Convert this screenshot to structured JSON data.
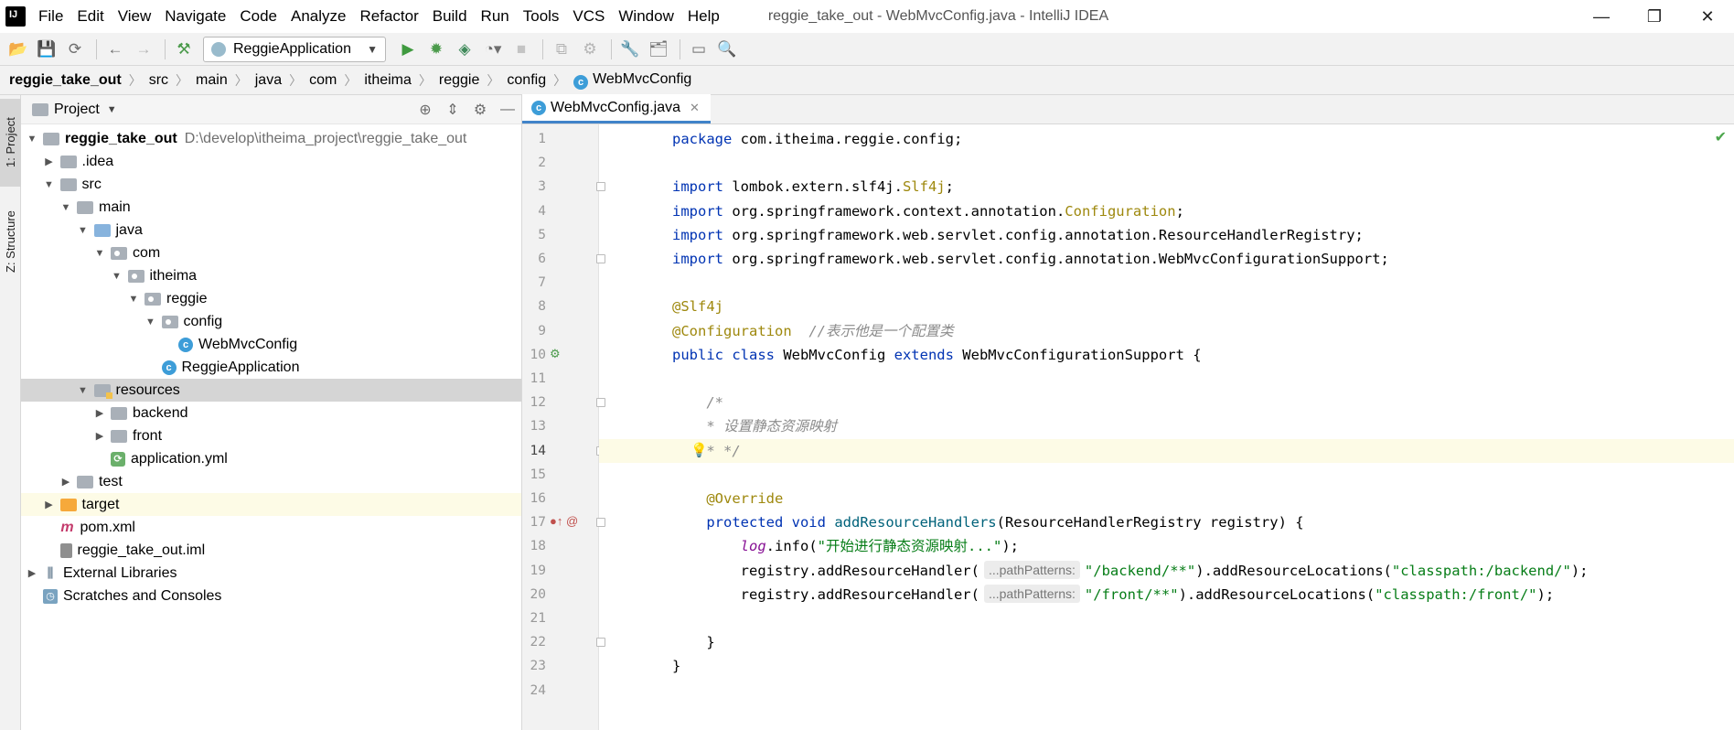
{
  "app": {
    "logo_text": "IJ",
    "window_title": "reggie_take_out - WebMvcConfig.java - IntelliJ IDEA",
    "menu": [
      "File",
      "Edit",
      "View",
      "Navigate",
      "Code",
      "Analyze",
      "Refactor",
      "Build",
      "Run",
      "Tools",
      "VCS",
      "Window",
      "Help"
    ],
    "window_controls": {
      "minimize": "—",
      "restore": "❐",
      "close": "✕"
    }
  },
  "toolbar": {
    "run_config": "ReggieApplication",
    "icons": [
      "open-icon",
      "save-icon",
      "sync-icon",
      "back-icon",
      "forward-icon",
      "build-hammer-icon",
      "run-icon",
      "debug-icon",
      "coverage-icon",
      "profile-icon",
      "stop-icon",
      "attach-icon",
      "deploy-icon",
      "settings-wrench-icon",
      "project-structure-icon",
      "terminal-icon",
      "search-icon"
    ]
  },
  "breadcrumb": [
    "reggie_take_out",
    "src",
    "main",
    "java",
    "com",
    "itheima",
    "reggie",
    "config",
    "WebMvcConfig"
  ],
  "side_strip": {
    "project_tab": "1: Project",
    "structure_tab": "Z: Structure"
  },
  "project_panel": {
    "title": "Project",
    "tree": [
      {
        "depth": 0,
        "arrow": "▼",
        "icon": "module",
        "label": "reggie_take_out",
        "extra": "D:\\develop\\itheima_project\\reggie_take_out",
        "bold": true
      },
      {
        "depth": 1,
        "arrow": "▶",
        "icon": "folder",
        "label": ".idea"
      },
      {
        "depth": 1,
        "arrow": "▼",
        "icon": "folder",
        "label": "src"
      },
      {
        "depth": 2,
        "arrow": "▼",
        "icon": "folder",
        "label": "main"
      },
      {
        "depth": 3,
        "arrow": "▼",
        "icon": "folder-blue",
        "label": "java"
      },
      {
        "depth": 4,
        "arrow": "▼",
        "icon": "package",
        "label": "com"
      },
      {
        "depth": 5,
        "arrow": "▼",
        "icon": "package",
        "label": "itheima"
      },
      {
        "depth": 6,
        "arrow": "▼",
        "icon": "package",
        "label": "reggie"
      },
      {
        "depth": 7,
        "arrow": "▼",
        "icon": "package",
        "label": "config"
      },
      {
        "depth": 8,
        "arrow": "",
        "icon": "class",
        "label": "WebMvcConfig"
      },
      {
        "depth": 7,
        "arrow": "",
        "icon": "class",
        "label": "ReggieApplication"
      },
      {
        "depth": 3,
        "arrow": "▼",
        "icon": "resources",
        "label": "resources",
        "selected": true
      },
      {
        "depth": 4,
        "arrow": "▶",
        "icon": "folder",
        "label": "backend"
      },
      {
        "depth": 4,
        "arrow": "▶",
        "icon": "folder",
        "label": "front"
      },
      {
        "depth": 4,
        "arrow": "",
        "icon": "yml",
        "label": "application.yml"
      },
      {
        "depth": 2,
        "arrow": "▶",
        "icon": "folder",
        "label": "test"
      },
      {
        "depth": 1,
        "arrow": "▶",
        "icon": "folder-orange",
        "label": "target",
        "highlight": true
      },
      {
        "depth": 1,
        "arrow": "",
        "icon": "maven",
        "label": "pom.xml"
      },
      {
        "depth": 1,
        "arrow": "",
        "icon": "iml",
        "label": "reggie_take_out.iml"
      },
      {
        "depth": 0,
        "arrow": "▶",
        "icon": "library",
        "label": "External Libraries"
      },
      {
        "depth": 0,
        "arrow": "",
        "icon": "scratch",
        "label": "Scratches and Consoles"
      }
    ]
  },
  "editor": {
    "tab_label": "WebMvcConfig.java",
    "current_line": 14,
    "lines": [
      {
        "n": "1",
        "html": "<span class=\"kw\">package</span> com.itheima.reggie.config;"
      },
      {
        "n": "2",
        "html": ""
      },
      {
        "n": "3",
        "html": "<span class=\"kw\">import</span> lombok.extern.slf4j.<span class=\"ann\">Slf4j</span>;"
      },
      {
        "n": "4",
        "html": "<span class=\"kw\">import</span> org.springframework.context.annotation.<span class=\"ann\">Configuration</span>;"
      },
      {
        "n": "5",
        "html": "<span class=\"kw\">import</span> org.springframework.web.servlet.config.annotation.ResourceHandlerRegistry;"
      },
      {
        "n": "6",
        "html": "<span class=\"kw\">import</span> org.springframework.web.servlet.config.annotation.WebMvcConfigurationSupport;"
      },
      {
        "n": "7",
        "html": ""
      },
      {
        "n": "8",
        "html": "<span class=\"ann\">@Slf4j</span>"
      },
      {
        "n": "9",
        "html": "<span class=\"ann\">@Configuration</span>  <span class=\"cm\">//表示他是一个配置类</span>"
      },
      {
        "n": "10",
        "html": "<span class=\"kw\">public class</span> WebMvcConfig <span class=\"kw\">extends</span> WebMvcConfigurationSupport {"
      },
      {
        "n": "11",
        "html": ""
      },
      {
        "n": "12",
        "html": "    <span class=\"cm\">/*</span>"
      },
      {
        "n": "13",
        "html": "    <span class=\"cm\">* 设置静态资源映射</span>"
      },
      {
        "n": "14",
        "html": "    <span class=\"cm\">* */</span>"
      },
      {
        "n": "15",
        "html": ""
      },
      {
        "n": "16",
        "html": "    <span class=\"ann\">@Override</span>"
      },
      {
        "n": "17",
        "html": "    <span class=\"kw\">protected void</span> <span class=\"fn\">addResourceHandlers</span>(ResourceHandlerRegistry registry) {"
      },
      {
        "n": "18",
        "html": "        <span class=\"fld\">log</span>.info(<span class=\"str\">\"开始进行静态资源映射...\"</span>);"
      },
      {
        "n": "19",
        "html": "        registry.addResourceHandler(<span class=\"hint\">...pathPatterns:</span><span class=\"str\">\"/backend/**\"</span>).addResourceLocations(<span class=\"str\">\"classpath:/backend/\"</span>);"
      },
      {
        "n": "20",
        "html": "        registry.addResourceHandler(<span class=\"hint\">...pathPatterns:</span><span class=\"str\">\"/front/**\"</span>).addResourceLocations(<span class=\"str\">\"classpath:/front/\"</span>);"
      },
      {
        "n": "21",
        "html": ""
      },
      {
        "n": "22",
        "html": "    }"
      },
      {
        "n": "23",
        "html": "}"
      },
      {
        "n": "24",
        "html": ""
      }
    ]
  }
}
